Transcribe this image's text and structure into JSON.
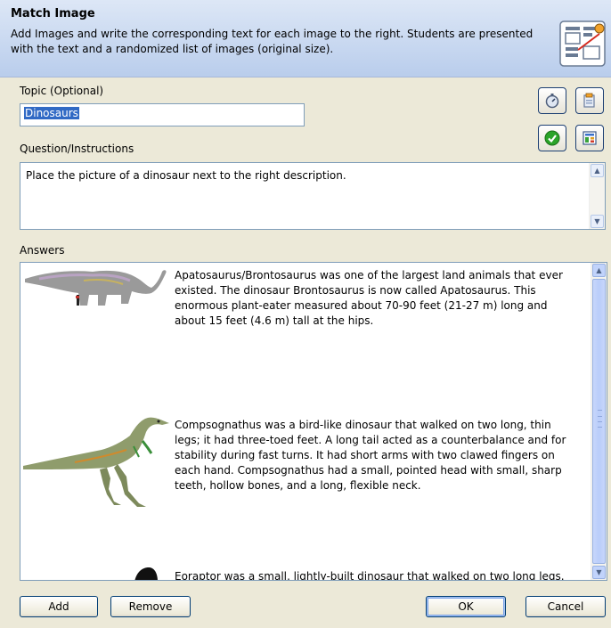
{
  "header": {
    "title": "Match Image",
    "description": "Add Images and write the corresponding text for each image to the right. Students are presented with the text and a randomized list of images (original size).",
    "icon": "match-image-icon"
  },
  "topic": {
    "label": "Topic (Optional)",
    "value": "Dinosaurs"
  },
  "question": {
    "label": "Question/Instructions",
    "value": "Place the picture of a dinosaur next to the right description."
  },
  "tool_buttons": [
    {
      "name": "timer-button",
      "icon": "stopwatch-icon"
    },
    {
      "name": "clipboard-button",
      "icon": "clipboard-icon"
    },
    {
      "name": "check-button",
      "icon": "checkmark-icon",
      "color": "#2aa329"
    },
    {
      "name": "layout-button",
      "icon": "layout-icon"
    }
  ],
  "answers": {
    "label": "Answers",
    "items": [
      {
        "image": "apatosaurus-image",
        "text": "Apatosaurus/Brontosaurus was one of the largest land animals that ever existed. The dinosaur Brontosaurus is now called Apatosaurus. This enormous plant-eater measured about 70-90 feet (21-27 m) long and about 15 feet (4.6 m) tall at the hips."
      },
      {
        "image": "compsognathus-image",
        "text": "Compsognathus was a bird-like dinosaur that walked on two long, thin legs; it had three-toed feet. A long tail acted as a counterbalance and for stability during fast turns. It had short arms with two clawed fingers on each hand. Compsognathus had a small, pointed head with small, sharp teeth, hollow bones, and a long, flexible neck."
      },
      {
        "image": "eoraptor-image",
        "text": "Eoraptor was a small, lightly-built dinosaur that walked on two long legs."
      }
    ]
  },
  "buttons": {
    "add": "Add",
    "remove": "Remove",
    "ok": "OK",
    "cancel": "Cancel"
  },
  "colors": {
    "header_gradient_top": "#dde7f6",
    "header_gradient_bottom": "#b9cdec",
    "selection": "#316ac5",
    "dialog_bg": "#ece9d8"
  }
}
